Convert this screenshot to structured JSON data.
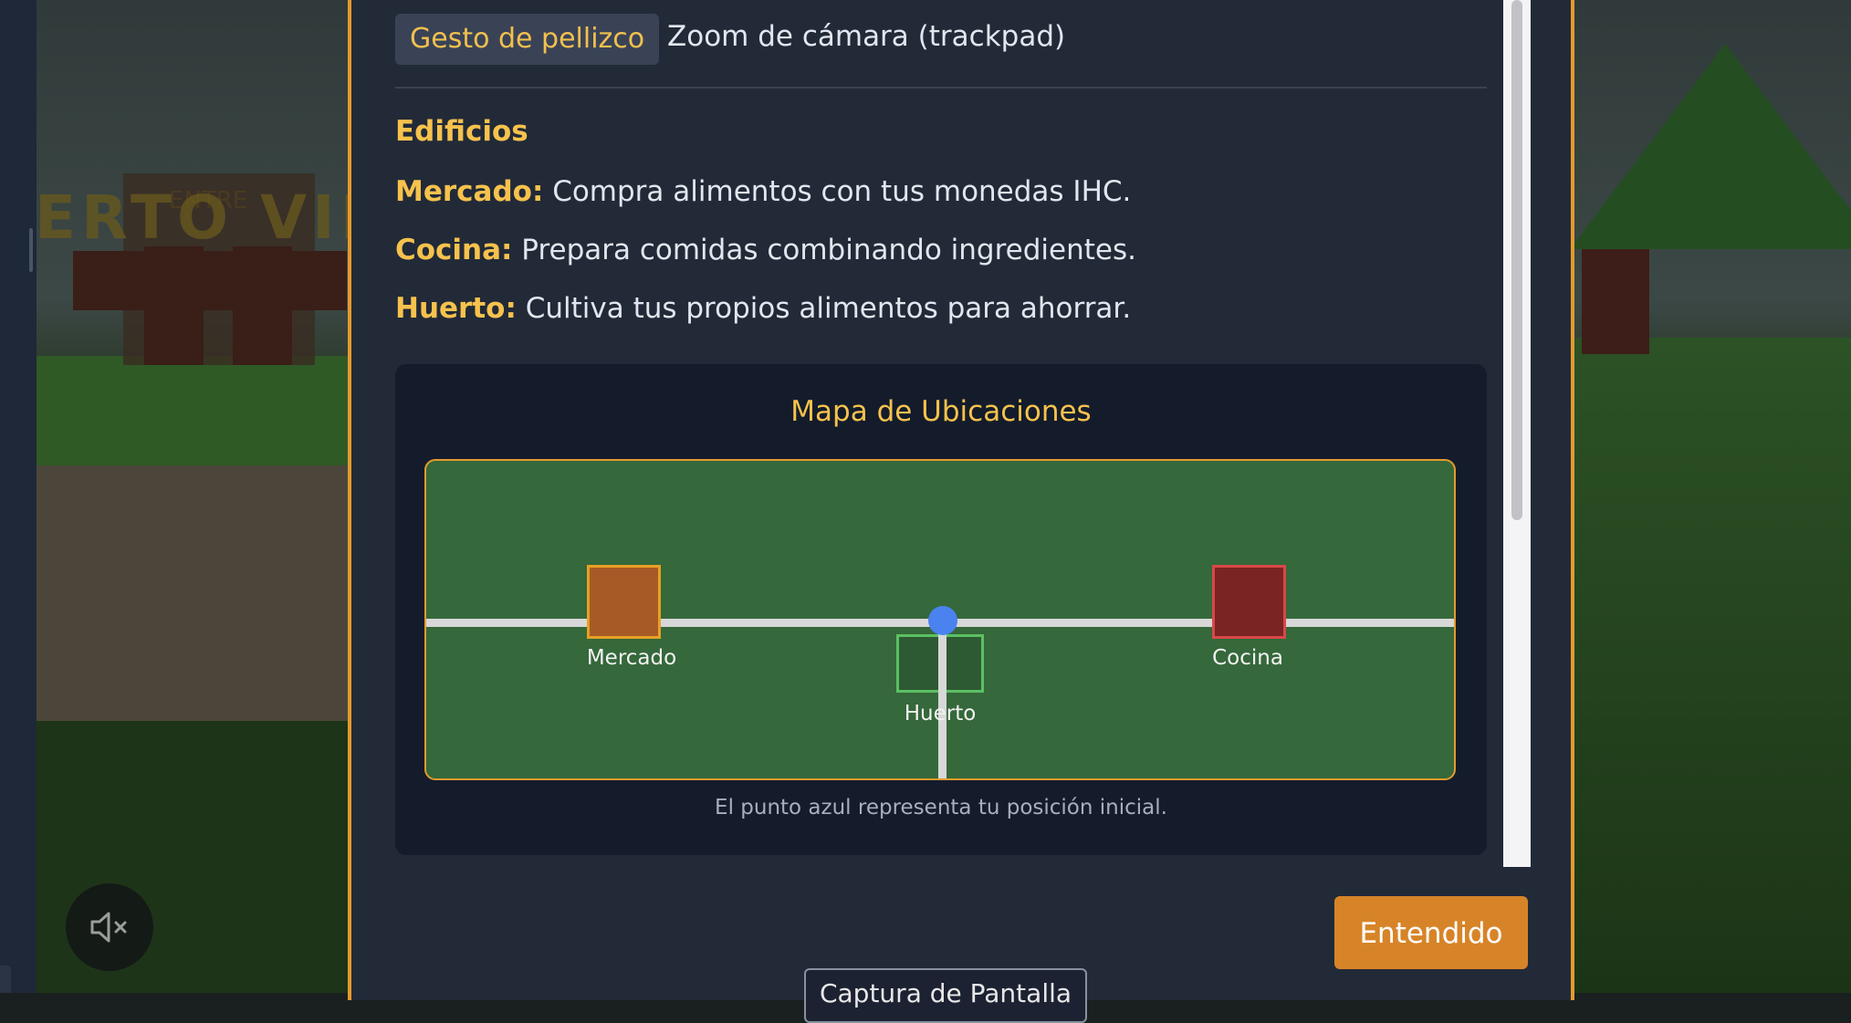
{
  "background": {
    "sign_text": "ERTO VIRT",
    "sign_small": "ENTRE"
  },
  "controls": {
    "pinch_key": "Gesto de pellizco",
    "pinch_desc": "Zoom de cámara (trackpad)"
  },
  "buildings_section": {
    "title": "Edificios",
    "items": [
      {
        "name": "Mercado:",
        "desc": " Compra alimentos con tus monedas IHC."
      },
      {
        "name": "Cocina:",
        "desc": " Prepara comidas combinando ingredientes."
      },
      {
        "name": "Huerto:",
        "desc": " Cultiva tus propios alimentos para ahorrar."
      }
    ]
  },
  "map": {
    "title": "Mapa de Ubicaciones",
    "labels": {
      "market": "Mercado",
      "kitchen": "Cocina",
      "garden": "Huerto"
    },
    "caption": "El punto azul representa tu posición inicial.",
    "colors": {
      "field": "#35683a",
      "market": "#a85a26",
      "kitchen": "#7a2424",
      "garden": "#2d5a32",
      "player": "#4a82f0"
    }
  },
  "footer": {
    "ok_label": "Entendido",
    "capture_label": "Captura de Pantalla"
  },
  "icons": {
    "mute": "speaker-muted-icon"
  }
}
